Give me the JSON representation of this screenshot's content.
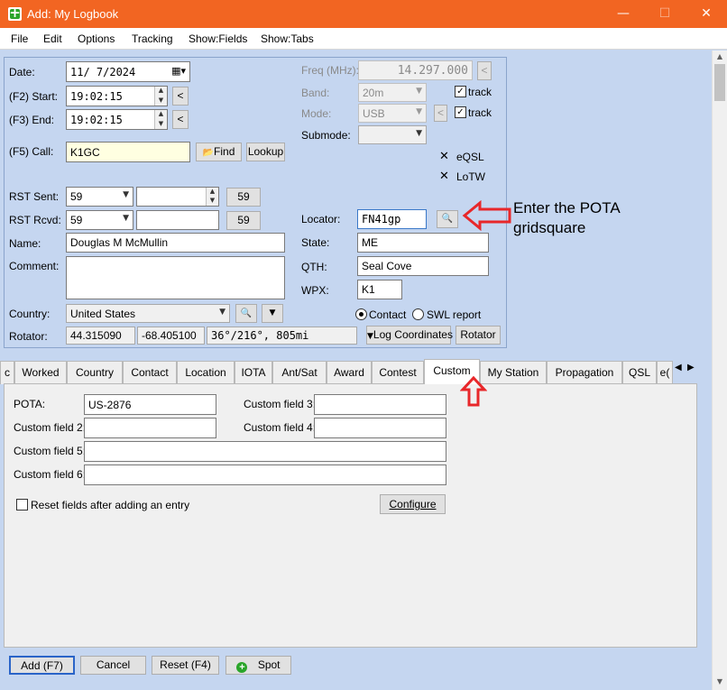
{
  "window": {
    "title": "Add: My Logbook",
    "accent": "#f26522"
  },
  "menu": {
    "file": "File",
    "edit": "Edit",
    "options": "Options",
    "tracking": "Tracking",
    "show_fields": "Show:Fields",
    "show_tabs": "Show:Tabs"
  },
  "form": {
    "date_label": "Date:",
    "date_value": "11/ 7/2024",
    "start_label": "(F2) Start:",
    "start_value": "19:02:15",
    "end_label": "(F3) End:",
    "end_value": "19:02:15",
    "call_label": "(F5) Call:",
    "call_value": "K1GC",
    "find_label": "Find",
    "lookup_label": "Lookup",
    "rst_sent_label": "RST Sent:",
    "rst_sent_value": "59",
    "rst_sent_btn": "59",
    "rst_rcvd_label": "RST Rcvd:",
    "rst_rcvd_value": "59",
    "rst_rcvd_btn": "59",
    "name_label": "Name:",
    "name_value": "Douglas M McMullin",
    "comment_label": "Comment:",
    "comment_value": "",
    "country_label": "Country:",
    "country_value": "United States",
    "rotator_label": "Rotator:",
    "rotator_lat": "44.315090",
    "rotator_lon": "-68.405100",
    "rotator_bearing": "36°/216°, 805mi",
    "freq_label": "Freq (MHz):",
    "freq_value": "14.297.000",
    "band_label": "Band:",
    "band_value": "20m",
    "mode_label": "Mode:",
    "mode_value": "USB",
    "submode_label": "Submode:",
    "submode_value": "",
    "track_label": "track",
    "track2_label": "track",
    "eqsl_label": "eQSL",
    "lotw_label": "LoTW",
    "locator_label": "Locator:",
    "locator_value": "FN41gp",
    "state_label": "State:",
    "state_value": "ME",
    "qth_label": "QTH:",
    "qth_value": "Seal Cove",
    "wpx_label": "WPX:",
    "wpx_value": "K1",
    "contact_label": "Contact",
    "swl_label": "SWL report",
    "log_coords_label": "Log Coordinates",
    "rotator_btn_label": "Rotator"
  },
  "annotation": {
    "line1": "Enter the POTA",
    "line2": "gridsquare",
    "color": "#e8272a"
  },
  "tabs": [
    "Worked",
    "Country",
    "Contact",
    "Location",
    "IOTA",
    "Ant/Sat",
    "Award",
    "Contest",
    "Custom",
    "My Station",
    "Propagation",
    "QSL",
    "e("
  ],
  "tabs_active": "Custom",
  "custom": {
    "pota_label": "POTA:",
    "pota_value": "US-2876",
    "cf2_label": "Custom field 2:",
    "cf2_value": "",
    "cf3_label": "Custom field 3:",
    "cf3_value": "",
    "cf4_label": "Custom field 4:",
    "cf4_value": "",
    "cf5_label": "Custom field 5:",
    "cf5_value": "",
    "cf6_label": "Custom field 6:",
    "cf6_value": "",
    "reset_label": "Reset fields after adding an entry",
    "configure_label": "Configure"
  },
  "bottom": {
    "add_label": "Add (F7)",
    "cancel_label": "Cancel",
    "reset_label": "Reset (F4)",
    "spot_label": "Spot"
  }
}
